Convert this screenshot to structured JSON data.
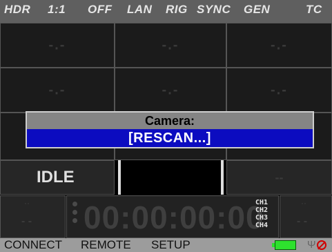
{
  "status_bar": {
    "hdr": "HDR",
    "ratio": "1:1",
    "off": "OFF",
    "lan": "LAN",
    "rig": "RIG",
    "sync": "SYNC",
    "gen": "GEN",
    "tc": "TC"
  },
  "grid": {
    "placeholders": [
      "-.-",
      "-.-",
      "-.-",
      "-.-",
      "-.-",
      "-.-",
      "-.-",
      "-.-",
      "-.-"
    ]
  },
  "status": {
    "state": "IDLE"
  },
  "timecode": {
    "value": "00:00:00:00",
    "channels": [
      "CH1",
      "CH2",
      "CH3",
      "CH4"
    ]
  },
  "dialog": {
    "title": "Camera:",
    "option": "[RESCAN...]"
  },
  "menu": {
    "connect": "CONNECT",
    "remote": "REMOTE",
    "setup": "SETUP"
  },
  "colors": {
    "selection": "#0c0cc0",
    "battery": "#2ee12e",
    "no_signal": "#d10000"
  },
  "icons": [
    "battery-icon",
    "antenna-icon",
    "no-signal-icon"
  ]
}
